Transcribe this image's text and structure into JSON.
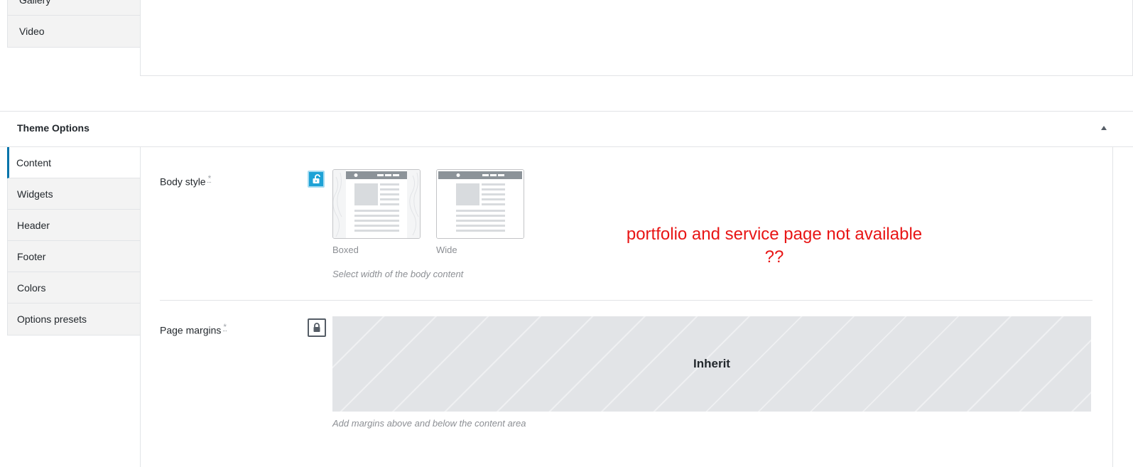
{
  "top_tabs": [
    {
      "label": "Gallery"
    },
    {
      "label": "Video"
    }
  ],
  "metabox": {
    "title": "Theme Options"
  },
  "side_tabs": [
    {
      "label": "Content",
      "active": true
    },
    {
      "label": "Widgets",
      "active": false
    },
    {
      "label": "Header",
      "active": false
    },
    {
      "label": "Footer",
      "active": false
    },
    {
      "label": "Colors",
      "active": false
    },
    {
      "label": "Options presets",
      "active": false
    }
  ],
  "body_style": {
    "label": "Body style",
    "required_mark": "*",
    "lock_state": "unlocked",
    "options": [
      {
        "label": "Boxed"
      },
      {
        "label": "Wide"
      }
    ],
    "help": "Select width of the body content"
  },
  "page_margins": {
    "label": "Page margins",
    "required_mark": "*",
    "lock_state": "locked",
    "value": "Inherit",
    "help": "Add margins above and below the content area"
  },
  "annotation": {
    "line1": "portfolio and service page not available",
    "line2": "??"
  },
  "colors": {
    "accent": "#0073aa",
    "lock_unlocked": "#1ea2d6",
    "annotation": "#e81515"
  },
  "icons": {
    "collapse": "triangle-up-icon",
    "lock_open": "unlock-icon",
    "lock_closed": "lock-icon"
  }
}
